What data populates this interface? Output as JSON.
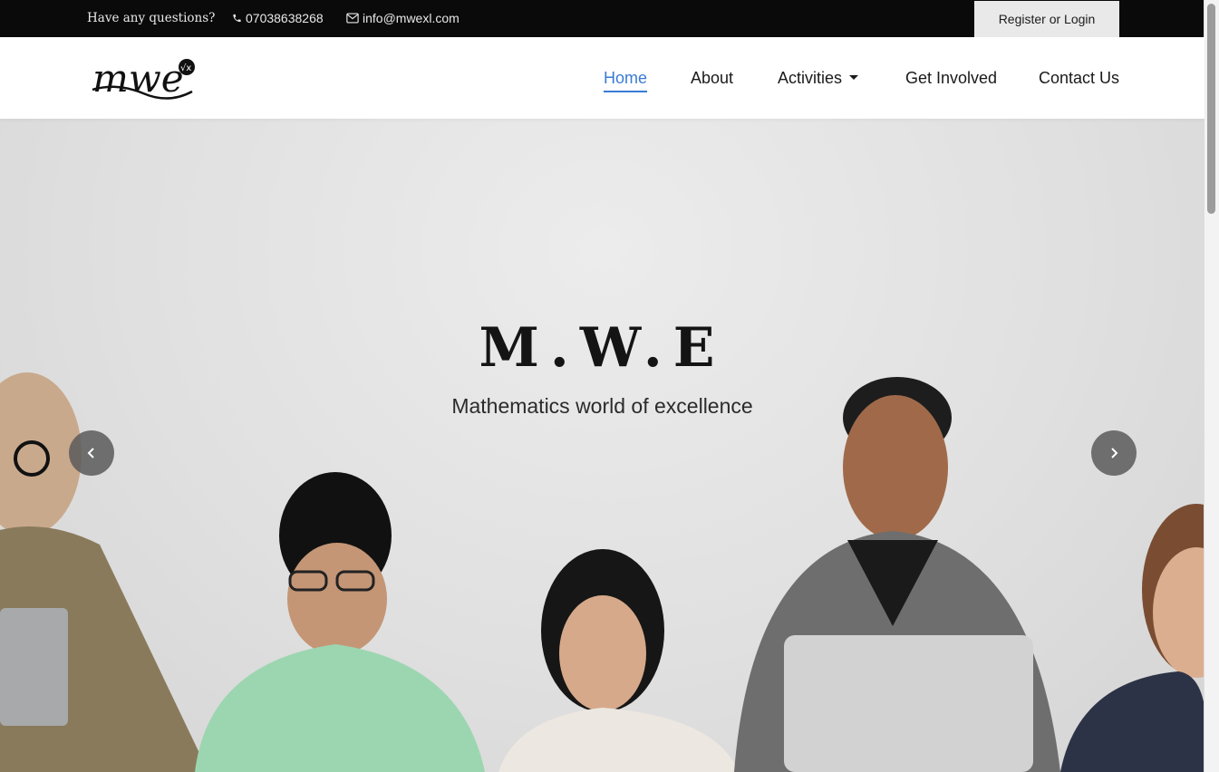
{
  "topbar": {
    "question": "Have any questions?",
    "phone": "07038638268",
    "email": "info@mwexl.com",
    "register_label": "Register or Login"
  },
  "nav": {
    "logo_text": "mwe",
    "items": [
      {
        "label": "Home",
        "active": true
      },
      {
        "label": "About"
      },
      {
        "label": "Activities",
        "dropdown": true
      },
      {
        "label": "Get Involved"
      },
      {
        "label": "Contact Us"
      }
    ]
  },
  "hero": {
    "title": "M.W.E",
    "subtitle": "Mathematics world of excellence"
  },
  "icons": {
    "phone": "phone-icon",
    "email": "envelope-icon",
    "prev": "chevron-left-icon",
    "next": "chevron-right-icon"
  },
  "colors": {
    "topbar_bg": "#0a0a0a",
    "accent": "#3a7bd5",
    "register_bg": "#e9e9e9"
  }
}
